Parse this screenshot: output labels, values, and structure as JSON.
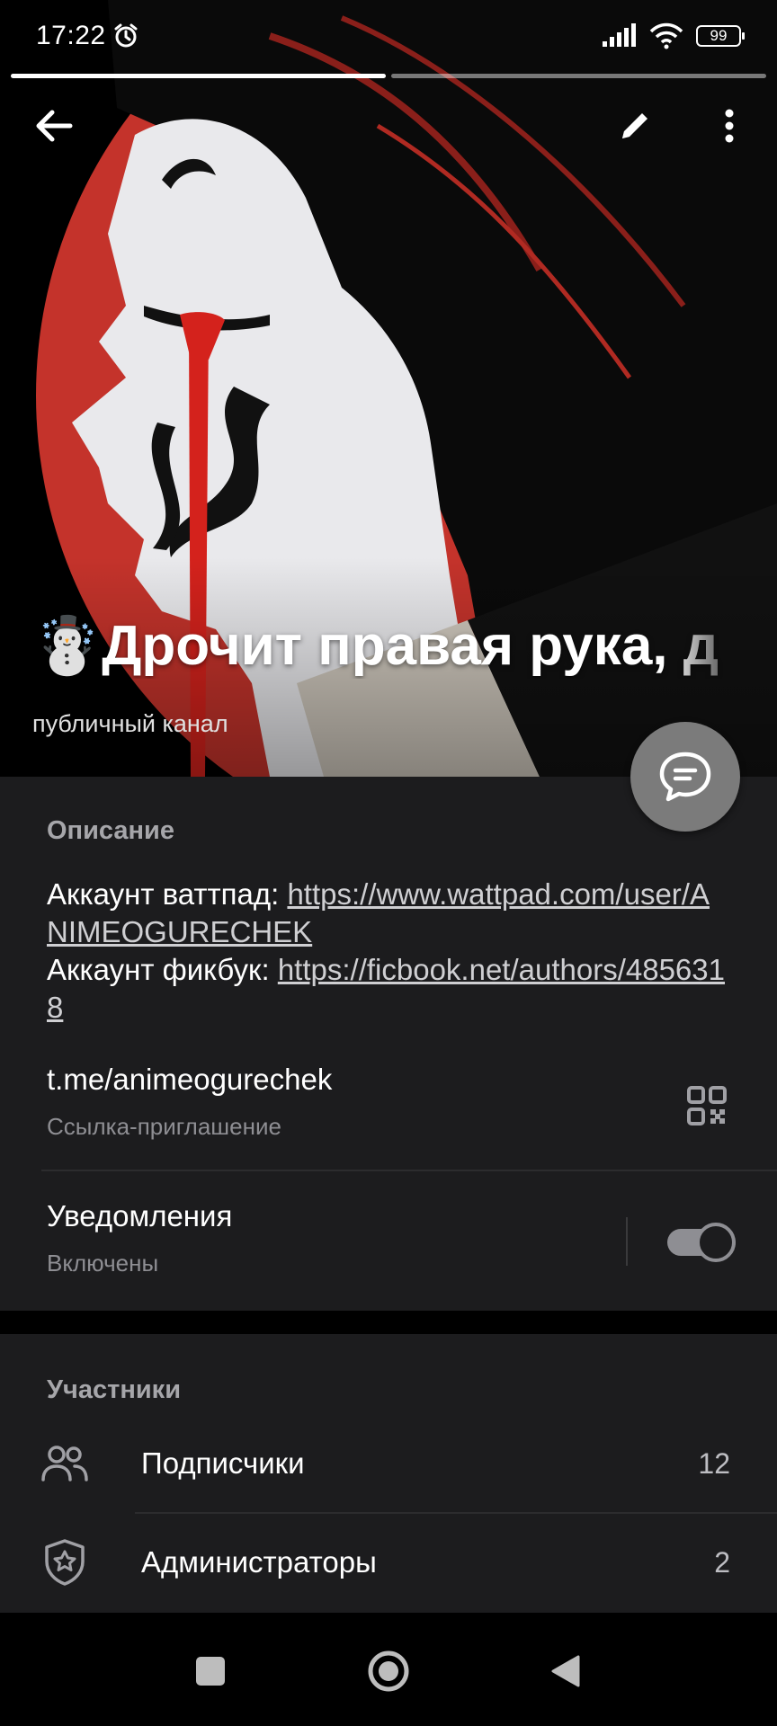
{
  "status_bar": {
    "time": "17:22",
    "battery": "99"
  },
  "stories": {
    "count": 2,
    "active_index": 0
  },
  "channel": {
    "emoji": "☃️",
    "title": "Дрочит правая рука, д",
    "type": "публичный канал"
  },
  "info": {
    "description_header": "Описание",
    "description": [
      {
        "prefix": "Аккаунт ваттпад: ",
        "link": "https://www.wattpad.com/user/ANIMEOGURECHEK"
      },
      {
        "prefix": "Аккаунт фикбук: ",
        "link": "https://ficbook.net/authors/4856318"
      }
    ],
    "invite_link": "t.me/animeogurechek",
    "invite_link_label": "Ссылка-приглашение",
    "notifications_label": "Уведомления",
    "notifications_state": "Включены",
    "notifications_on": true
  },
  "members": {
    "header": "Участники",
    "rows": [
      {
        "label": "Подписчики",
        "count": "12",
        "icon": "people-icon"
      },
      {
        "label": "Администраторы",
        "count": "2",
        "icon": "shield-star-icon"
      }
    ]
  },
  "colors": {
    "background": "#000000",
    "panel": "#1c1c1e",
    "secondary_text": "#8e8e93",
    "fab": "#7b7b7b",
    "hero_red": "#c4332b"
  }
}
